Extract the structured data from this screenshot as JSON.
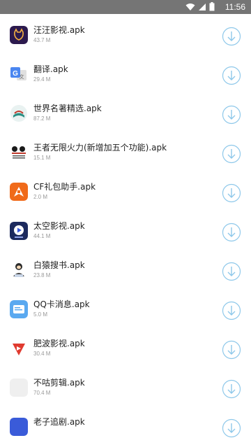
{
  "status_bar": {
    "time": "11:56",
    "icons": [
      "wifi-icon",
      "signal-icon",
      "battery-icon"
    ]
  },
  "colors": {
    "status_bar": "#757575",
    "download_accent": "#8ec8ea",
    "size_text": "#9a9a9a"
  },
  "files": [
    {
      "name": "汪汪影视.apk",
      "size": "43.7 M",
      "icon": "wangwang-app-icon"
    },
    {
      "name": "翻译.apk",
      "size": "29.4 M",
      "icon": "translate-app-icon"
    },
    {
      "name": "世界名著精选.apk",
      "size": "87.2 M",
      "icon": "books-app-icon"
    },
    {
      "name": "王者无限火力(新增加五个功能).apk",
      "size": "15.1 M",
      "icon": "king-app-icon"
    },
    {
      "name": "CF礼包助手.apk",
      "size": "2.0 M",
      "icon": "cf-app-icon"
    },
    {
      "name": "太空影视.apk",
      "size": "44.1 M",
      "icon": "space-video-app-icon"
    },
    {
      "name": "白猿搜书.apk",
      "size": "23.8 M",
      "icon": "ape-books-app-icon"
    },
    {
      "name": "QQ卡消息.apk",
      "size": "5.0 M",
      "icon": "qq-card-app-icon"
    },
    {
      "name": "肥波影视.apk",
      "size": "30.4 M",
      "icon": "feibo-video-app-icon"
    },
    {
      "name": "不咕剪辑.apk",
      "size": "70.4 M",
      "icon": "bugu-edit-app-icon"
    },
    {
      "name": "老子追剧.apk",
      "size": "",
      "icon": "laozi-app-icon"
    }
  ]
}
